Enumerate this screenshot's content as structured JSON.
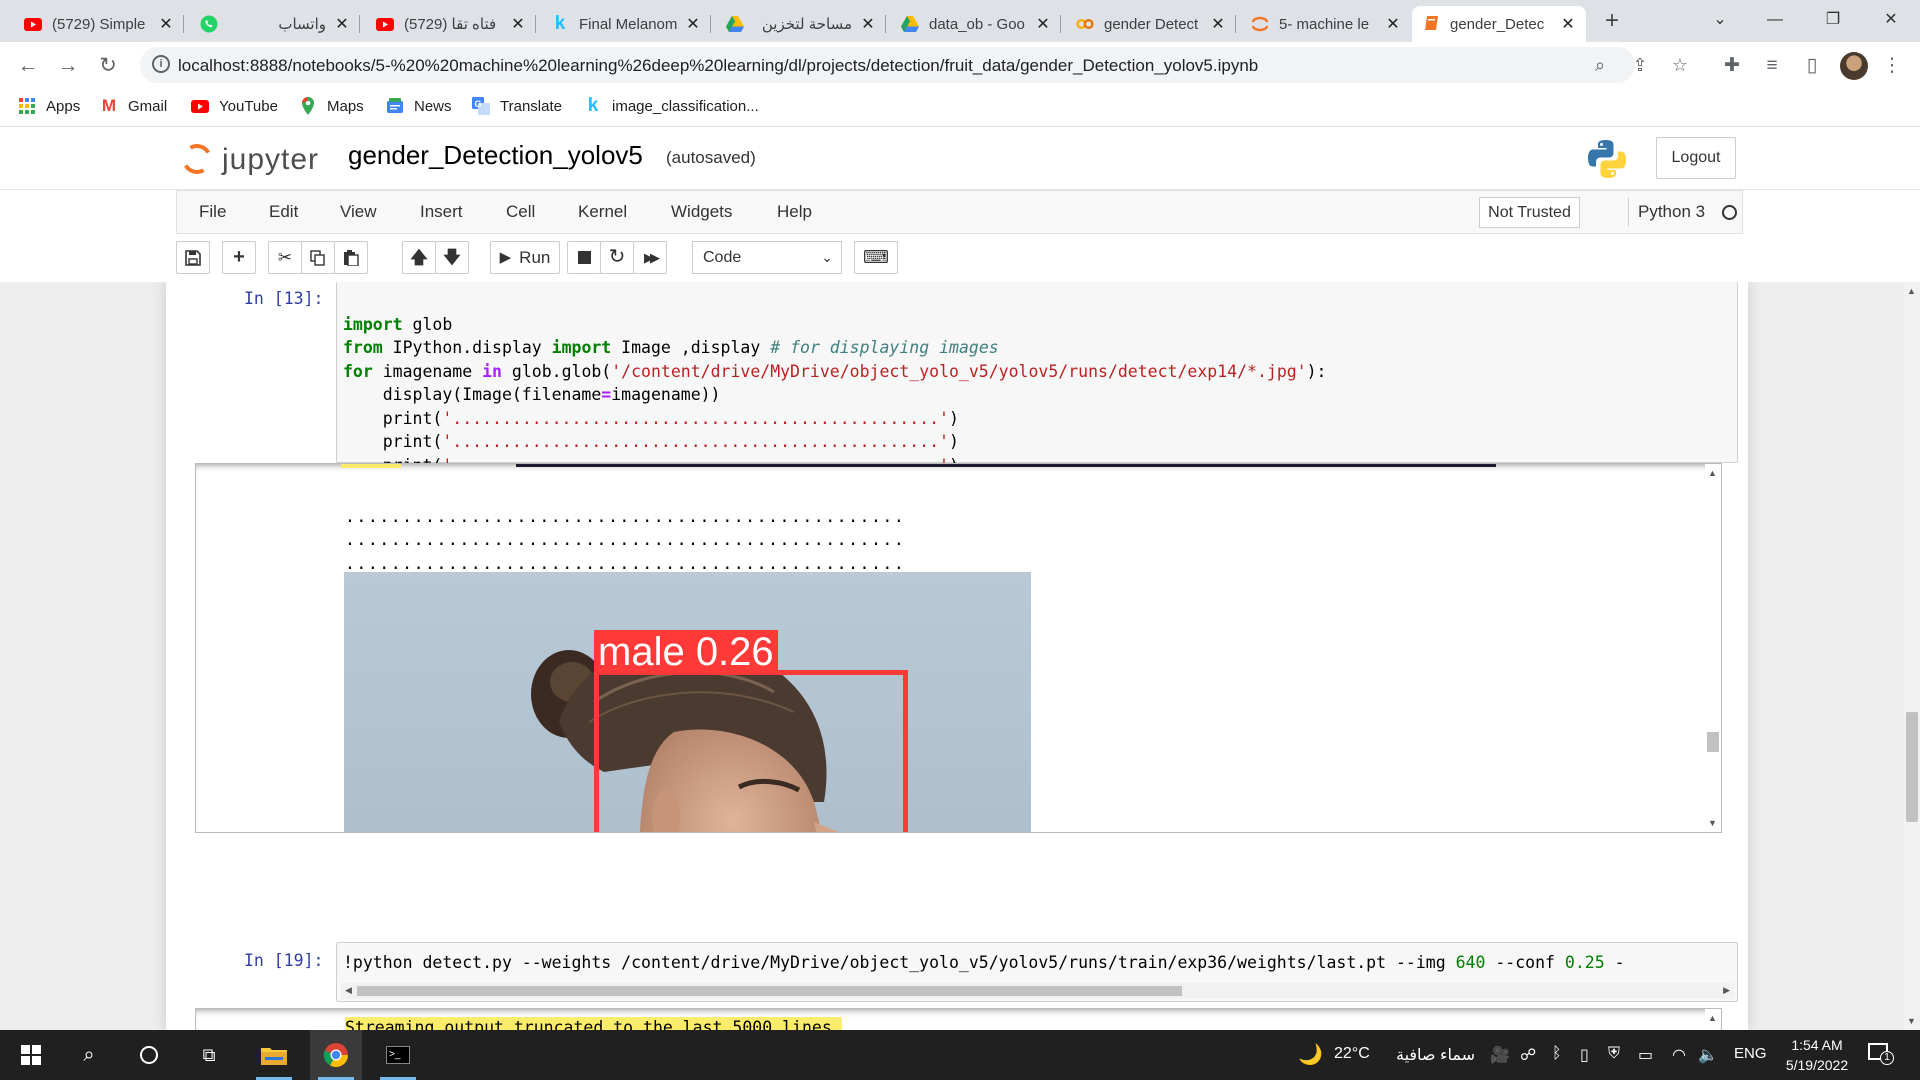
{
  "browser": {
    "tabs": [
      {
        "title": "(5729) Simple",
        "icon": "youtube-icon",
        "color": "#ff0000"
      },
      {
        "title": "واتساب",
        "icon": "whatsapp-icon",
        "color": "#25d366"
      },
      {
        "title": "(5729) فتاه تقا",
        "icon": "youtube-icon",
        "color": "#ff0000"
      },
      {
        "title": "Final Melanom",
        "icon": "kaggle-icon",
        "color": "#20beff"
      },
      {
        "title": "مساحة لتخزين",
        "icon": "google-drive-icon",
        "color": "#1fa463"
      },
      {
        "title": "data_ob - Goo",
        "icon": "google-drive-icon",
        "color": "#1fa463"
      },
      {
        "title": "gender Detect",
        "icon": "colab-icon",
        "color": "#f9ab00"
      },
      {
        "title": "5- machine le",
        "icon": "jupyter-icon",
        "color": "#f37626"
      },
      {
        "title": "gender_Detec",
        "icon": "notebook-icon",
        "color": "#f37626"
      }
    ],
    "new_tab": "+",
    "url": "localhost:8888/notebooks/5-%20%20machine%20learning%26deep%20learning/dl/projects/detection/fruit_data/gender_Detection_yolov5.ipynb",
    "bookmarks": [
      {
        "label": "Apps",
        "icon": "apps-grid-icon",
        "color": "#4285f4"
      },
      {
        "label": "Gmail",
        "icon": "gmail-icon",
        "color": "#ea4335"
      },
      {
        "label": "YouTube",
        "icon": "youtube-icon",
        "color": "#ff0000"
      },
      {
        "label": "Maps",
        "icon": "maps-icon",
        "color": "#34a853"
      },
      {
        "label": "News",
        "icon": "news-icon",
        "color": "#4285f4"
      },
      {
        "label": "Translate",
        "icon": "translate-icon",
        "color": "#4285f4"
      },
      {
        "label": "image_classification...",
        "icon": "kaggle-icon",
        "color": "#20beff"
      }
    ]
  },
  "jupyter": {
    "logo_text": "jupyter",
    "notebook_name": "gender_Detection_yolov5",
    "save_status": "(autosaved)",
    "logout_label": "Logout",
    "menus": [
      "File",
      "Edit",
      "View",
      "Insert",
      "Cell",
      "Kernel",
      "Widgets",
      "Help"
    ],
    "trust_label": "Not Trusted",
    "kernel_name": "Python 3",
    "toolbar": {
      "run_label": "Run",
      "cell_type": "Code"
    }
  },
  "cells": {
    "cell1": {
      "prompt": "In [13]:",
      "code": {
        "l1_kw": "import",
        "l1_rest": " glob",
        "l2_kw1": "from",
        "l2_mod": " IPython.display ",
        "l2_kw2": "import",
        "l2_rest": " Image ,display ",
        "l2_comment": "# for displaying images",
        "l3_kw1": "for",
        "l3_var": " imagename ",
        "l3_kw2": "in",
        "l3_call": " glob.glob(",
        "l3_str": "'/content/drive/MyDrive/object_yolo_v5/yolov5/runs/detect/exp14/*.jpg'",
        "l3_end": "):",
        "l4_a": "    display(Image(filename",
        "l4_op": "=",
        "l4_b": "imagename))",
        "print_call": "    print(",
        "print_str": "'.................................................'",
        "print_end": ")"
      },
      "output": {
        "dots": ".................................................",
        "detection_label": "male 0.26"
      }
    },
    "cell2": {
      "prompt": "In [19]:",
      "code": {
        "a": "!python detect.py --weights /content/drive/MyDrive/object_yolo_v5/yolov5/runs/train/exp36/weights/last.pt --img ",
        "n1": "640",
        "b": " --conf ",
        "n2": "0.25",
        "c": " -"
      },
      "output": "Streaming output truncated to the last 5000 lines."
    }
  },
  "taskbar": {
    "weather_temp": "22°C",
    "weather_desc": "سماء صافية",
    "language": "ENG",
    "time": "1:54 AM",
    "date": "5/19/2022",
    "notification_count": "1"
  }
}
